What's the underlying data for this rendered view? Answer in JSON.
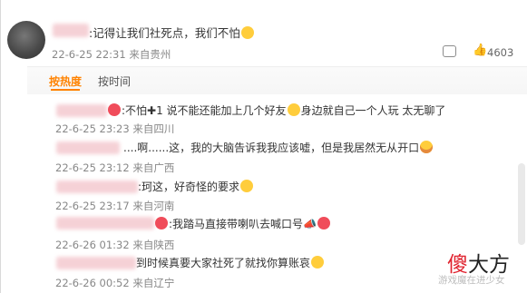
{
  "top_comment": {
    "text": ":记得让我们社死点，我们不怕",
    "meta": "22-6-25 22:31 来自贵州",
    "like_count": "4603"
  },
  "sort_tabs": {
    "hot": "按热度",
    "time": "按时间"
  },
  "replies": [
    {
      "text_a": ":不怕",
      "text_b": "1 说不能还能加上几个好友",
      "text_c": "身边就自己一个人玩 太无聊了",
      "meta": "22-6-25 23:23 来自四川"
    },
    {
      "text": "....啊......这，我的大脑告诉我我应该嘘，但是我居然无从开口",
      "meta": "22-6-25 23:12 来自广西"
    },
    {
      "text": ":珂这，好奇怪的要求",
      "meta": "22-6-25 23:17 来自河南"
    },
    {
      "text": ":我踏马直接带喇叭去喊口号",
      "meta": "22-6-26 01:32 来自陕西"
    },
    {
      "text": "到时候真要大家社死了就找你算账哀",
      "meta": "22-6-26 00:52 来自辽宁"
    }
  ],
  "watermark": {
    "char1": "傻",
    "rest": "大方",
    "sub": "游戏魔在进少女"
  }
}
